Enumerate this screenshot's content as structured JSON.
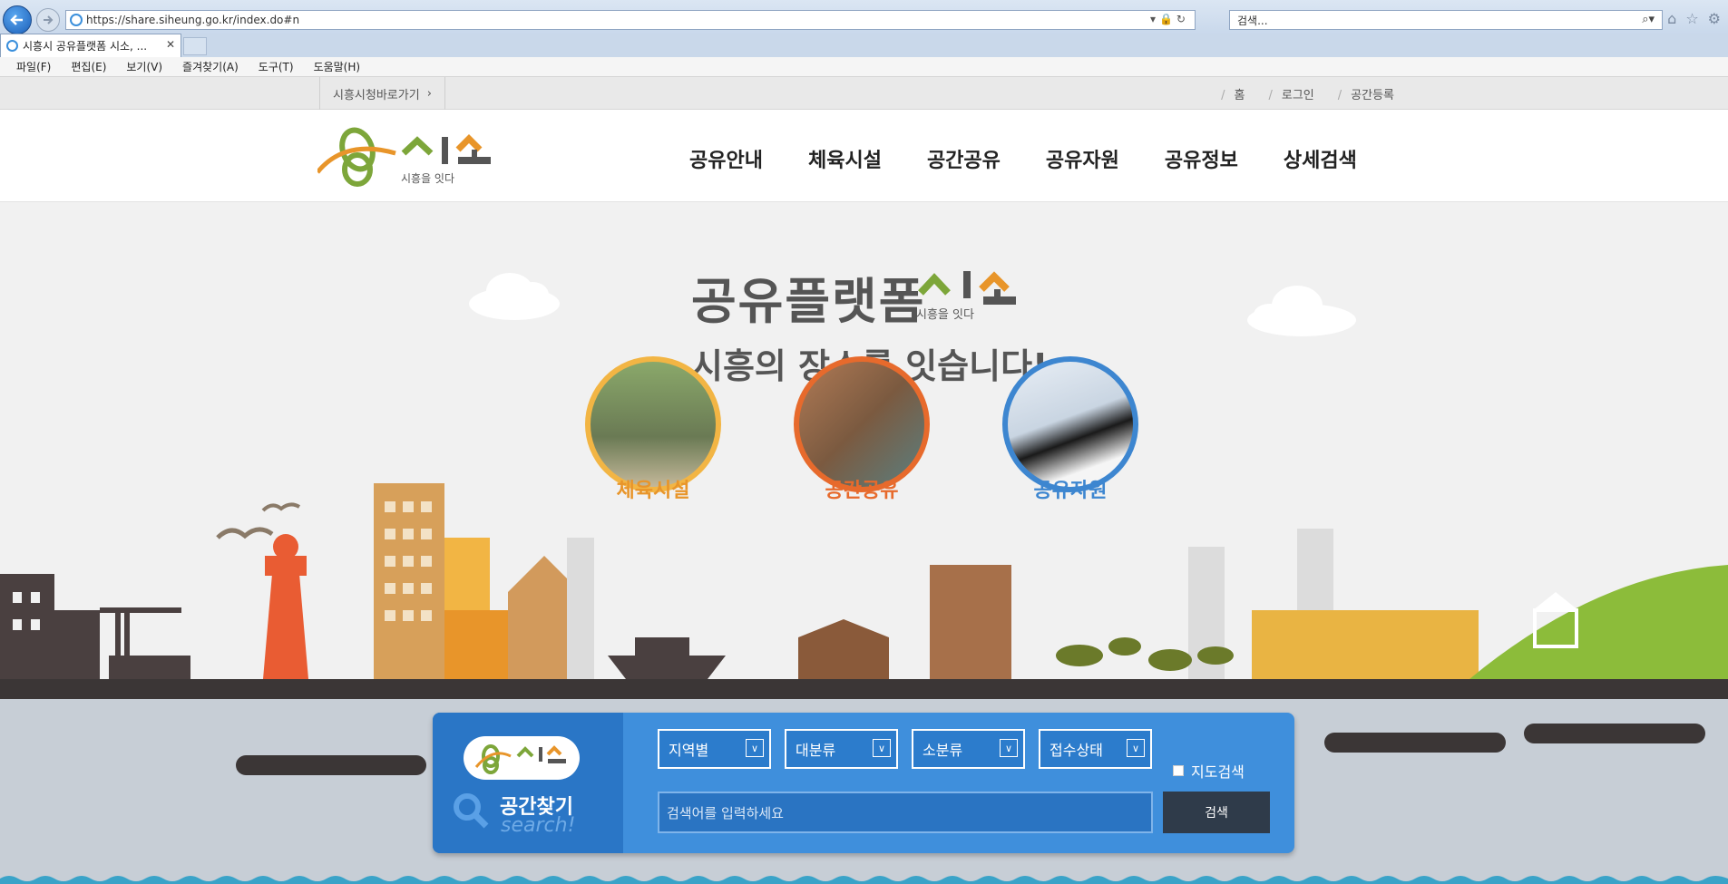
{
  "browser": {
    "url": "https://share.siheung.go.kr/index.do#n",
    "search_placeholder": "검색...",
    "tab_title": "시흥시 공유플랫폼 시소, ...",
    "menu": [
      "파일(F)",
      "편집(E)",
      "보기(V)",
      "즐겨찾기(A)",
      "도구(T)",
      "도움말(H)"
    ]
  },
  "util": {
    "shortcut": "시흥시청바로가기",
    "links": [
      "홈",
      "로그인",
      "공간등록"
    ]
  },
  "logo": {
    "tagline": "시흥을 잇다"
  },
  "gnb": [
    "공유안내",
    "체육시설",
    "공간공유",
    "공유자원",
    "공유정보",
    "상세검색"
  ],
  "hero": {
    "title": "공유플랫폼",
    "subtitle": "시흥의 장소를 잇습니다!",
    "logo_tagline": "시흥을 잇다"
  },
  "categories": [
    {
      "label": "체육시설",
      "color": "#e8952a"
    },
    {
      "label": "공간공유",
      "color": "#e76a2c"
    },
    {
      "label": "공유자원",
      "color": "#3d86d0"
    }
  ],
  "search": {
    "title": "공간찾기",
    "title_en": "search!",
    "selects": [
      "지역별",
      "대분류",
      "소분류",
      "접수상태"
    ],
    "map_search": "지도검색",
    "keyword_placeholder": "검색어를 입력하세요",
    "button": "검색"
  }
}
